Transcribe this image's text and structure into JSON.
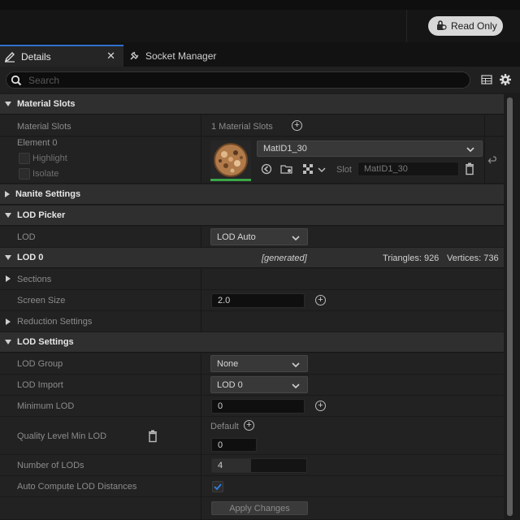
{
  "toolbar": {
    "read_only_label": "Read Only"
  },
  "tabs": [
    {
      "label": "Details",
      "active": true
    },
    {
      "label": "Socket Manager",
      "active": false
    }
  ],
  "search": {
    "placeholder": "Search"
  },
  "material_slots": {
    "header": "Material Slots",
    "slots_label": "Material Slots",
    "slots_value": "1 Material Slots",
    "element_label": "Element 0",
    "highlight_label": "Highlight",
    "isolate_label": "Isolate",
    "material_name": "MatID1_30",
    "slot_label": "Slot",
    "slot_value": "MatID1_30"
  },
  "nanite": {
    "header": "Nanite Settings"
  },
  "lod_picker": {
    "header": "LOD Picker",
    "lod_label": "LOD",
    "lod_value": "LOD Auto"
  },
  "lod0": {
    "header": "LOD 0",
    "generated": "[generated]",
    "triangles": "Triangles: 926",
    "vertices": "Vertices: 736",
    "sections_label": "Sections",
    "screen_size_label": "Screen Size",
    "screen_size_value": "2.0",
    "reduction_label": "Reduction Settings"
  },
  "lod_settings": {
    "header": "LOD Settings",
    "group_label": "LOD Group",
    "group_value": "None",
    "import_label": "LOD Import",
    "import_value": "LOD 0",
    "min_lod_label": "Minimum LOD",
    "min_lod_value": "0",
    "quality_label": "Quality Level Min LOD",
    "default_label": "Default",
    "quality_value": "0",
    "num_lods_label": "Number of LODs",
    "num_lods_value": "4",
    "auto_compute_label": "Auto Compute LOD Distances",
    "auto_compute_checked": true,
    "apply_label": "Apply Changes"
  },
  "colors": {
    "tab_accent": "#2f6fcf",
    "read_only_bg": "#d8d8d8",
    "thumbnail_underline": "#3aa648"
  },
  "icons": [
    "lock-icon",
    "pencil-icon",
    "close-icon",
    "socket-icon",
    "search-icon",
    "table-icon",
    "gear-icon",
    "plus-icon",
    "chevron-down-icon",
    "reset-arrow-icon",
    "browse-icon",
    "folder-icon",
    "checker-icon",
    "trash-icon"
  ]
}
